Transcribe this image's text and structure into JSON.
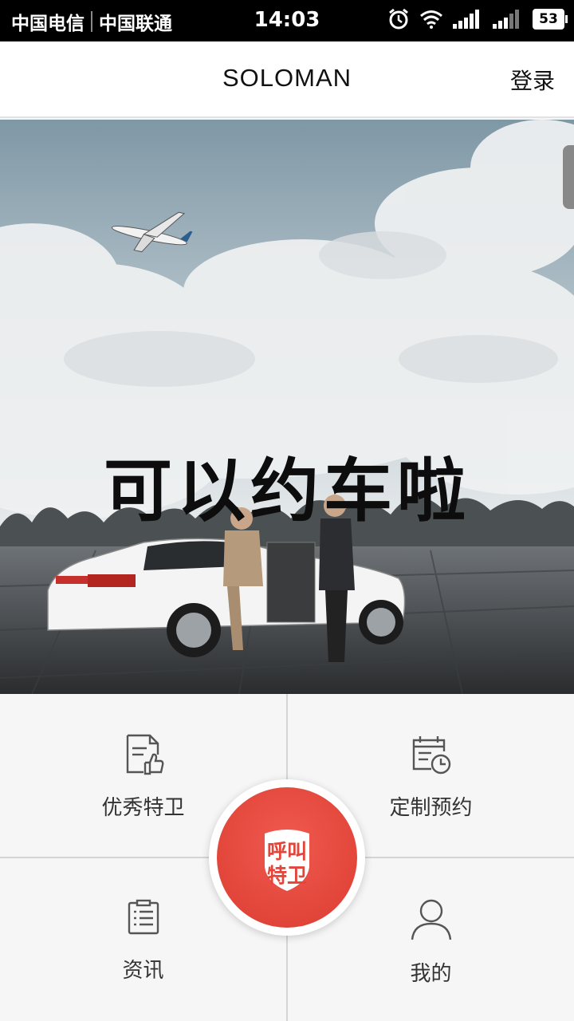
{
  "status_bar": {
    "carrier1": "中国电信",
    "carrier2": "中国联通",
    "time": "14:03",
    "battery": "53",
    "icons": [
      "alarm-icon",
      "wifi-icon",
      "signal-icon",
      "signal-icon"
    ]
  },
  "header": {
    "title": "SOLOMAN",
    "login": "登录"
  },
  "banner": {
    "headline": "可以约车啦"
  },
  "menu": {
    "items": [
      {
        "label": "优秀特卫",
        "icon": "document-thumbs-up-icon"
      },
      {
        "label": "定制预约",
        "icon": "calendar-clock-icon"
      },
      {
        "label": "资讯",
        "icon": "news-list-icon"
      },
      {
        "label": "我的",
        "icon": "user-icon"
      }
    ],
    "call_button": {
      "line1": "呼叫",
      "line2": "特卫",
      "icon": "shield-icon"
    }
  },
  "colors": {
    "accent": "#e2453a",
    "status_bar_bg": "#000000",
    "grid_bg": "#f6f6f6",
    "divider": "#d4d4d4"
  }
}
